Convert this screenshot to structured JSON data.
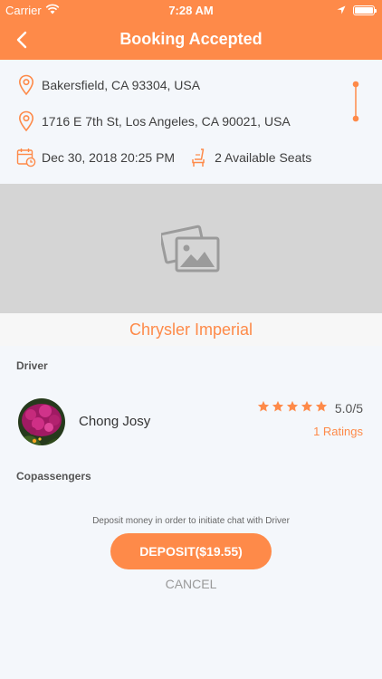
{
  "status_bar": {
    "carrier": "Carrier",
    "time": "7:28 AM"
  },
  "nav": {
    "title": "Booking Accepted"
  },
  "route": {
    "origin": "Bakersfield, CA 93304, USA",
    "destination": "1716 E 7th St, Los Angeles, CA 90021, USA",
    "datetime": "Dec 30, 2018 20:25 PM",
    "seats": "2 Available Seats"
  },
  "car": {
    "name": "Chrysler Imperial"
  },
  "driver": {
    "section_label": "Driver",
    "name": "Chong Josy",
    "rating_value": 5,
    "rating_text": "5.0/5",
    "ratings_count": "1 Ratings"
  },
  "copassengers": {
    "section_label": "Copassengers"
  },
  "deposit": {
    "note": "Deposit money in order to initiate chat with Driver",
    "button_label": "DEPOSIT($19.55)",
    "cancel_label": "CANCEL"
  },
  "colors": {
    "accent": "#fe8a49",
    "image_placeholder": "#d5d5d5",
    "background": "#f4f7fb"
  }
}
